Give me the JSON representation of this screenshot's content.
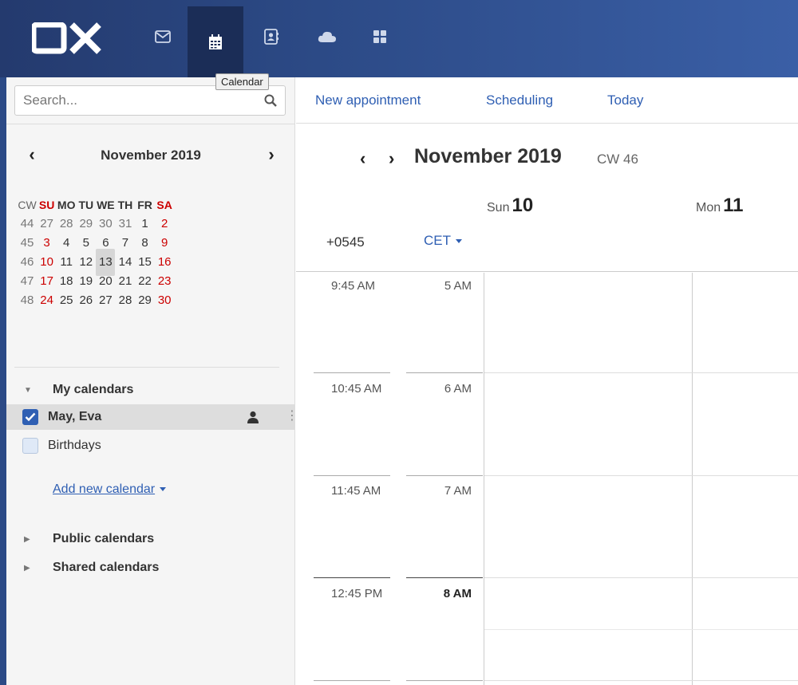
{
  "app": {
    "logo": "OX",
    "tooltip": "Calendar",
    "nav": [
      {
        "icon": "mail-icon"
      },
      {
        "icon": "calendar-icon",
        "active": true
      },
      {
        "icon": "address-book-icon"
      },
      {
        "icon": "cloud-icon"
      },
      {
        "icon": "apps-grid-icon"
      }
    ],
    "colors": {
      "topbar": "#2c4a86",
      "accent": "#2f5fb3",
      "weekend": "#cc0000"
    }
  },
  "sidebar": {
    "search_placeholder": "Search...",
    "mini_calendar": {
      "title": "November 2019",
      "header": [
        "CW",
        "SU",
        "MO",
        "TU",
        "WE",
        "TH",
        "FR",
        "SA"
      ],
      "weeks": [
        {
          "cw": "44",
          "days": [
            "27",
            "28",
            "29",
            "30",
            "31",
            "1",
            "2"
          ]
        },
        {
          "cw": "45",
          "days": [
            "3",
            "4",
            "5",
            "6",
            "7",
            "8",
            "9"
          ]
        },
        {
          "cw": "46",
          "days": [
            "10",
            "11",
            "12",
            "13",
            "14",
            "15",
            "16"
          ]
        },
        {
          "cw": "47",
          "days": [
            "17",
            "18",
            "19",
            "20",
            "21",
            "22",
            "23"
          ]
        },
        {
          "cw": "48",
          "days": [
            "24",
            "25",
            "26",
            "27",
            "28",
            "29",
            "30"
          ]
        }
      ],
      "today": "13"
    },
    "my_calendars_label": "My calendars",
    "calendars": [
      {
        "name": "May, Eva",
        "checked": true
      },
      {
        "name": "Birthdays",
        "checked": false
      }
    ],
    "add_calendar": "Add new calendar",
    "public_calendars": "Public calendars",
    "shared_calendars": "Shared calendars"
  },
  "toolbar": {
    "new_appointment": "New appointment",
    "scheduling": "Scheduling",
    "today": "Today"
  },
  "calendar": {
    "month_title": "November 2019",
    "cw": "CW 46",
    "days": [
      {
        "dow": "Sun",
        "num": "10"
      },
      {
        "dow": "Mon",
        "num": "11"
      }
    ],
    "timezone_offset": "+0545",
    "timezone": "CET",
    "times_left": [
      "9:45 AM",
      "10:45 AM",
      "11:45 AM",
      "12:45 PM"
    ],
    "times_right": [
      "5 AM",
      "6 AM",
      "7 AM",
      "8 AM"
    ]
  }
}
